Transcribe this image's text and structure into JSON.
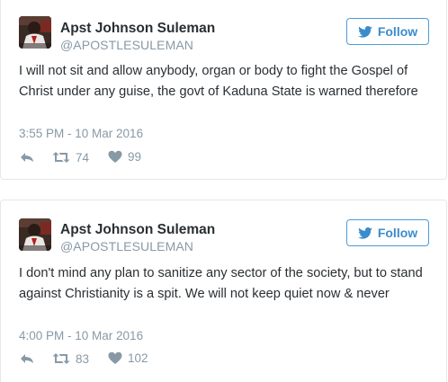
{
  "colors": {
    "accent": "#3b8ccc",
    "meta": "#8899a6",
    "text": "#292f33",
    "border": "#e1e8ed"
  },
  "tweets": [
    {
      "author": {
        "name": "Apst Johnson Suleman",
        "handle": "@APOSTLESULEMAN"
      },
      "follow_label": "Follow",
      "text": "I will not sit and allow anybody, organ or body to fight the Gospel of Christ under any guise, the govt of Kaduna State is warned therefore",
      "timestamp": "3:55 PM - 10 Mar 2016",
      "actions": {
        "reply_icon": "reply-icon",
        "retweet_icon": "retweet-icon",
        "retweets": "74",
        "like_icon": "heart-icon",
        "likes": "99"
      }
    },
    {
      "author": {
        "name": "Apst Johnson Suleman",
        "handle": "@APOSTLESULEMAN"
      },
      "follow_label": "Follow",
      "text": "I don't mind any plan to sanitize any sector of the society, but to stand against Christianity is a spit. We will not keep quiet now & never",
      "timestamp": "4:00 PM - 10 Mar 2016",
      "actions": {
        "reply_icon": "reply-icon",
        "retweet_icon": "retweet-icon",
        "retweets": "83",
        "like_icon": "heart-icon",
        "likes": "102"
      }
    }
  ]
}
